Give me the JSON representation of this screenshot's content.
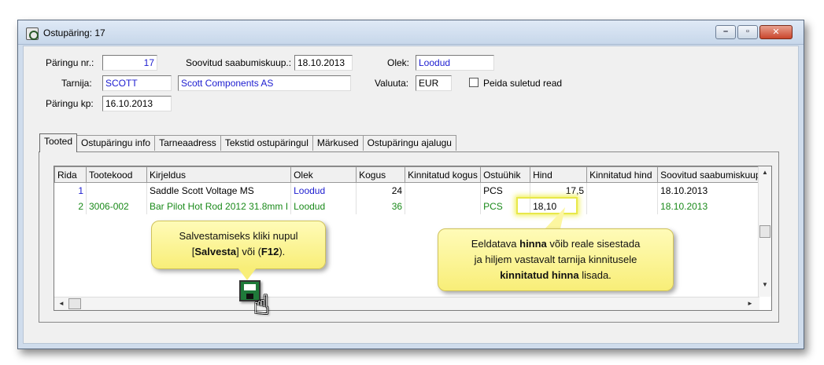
{
  "window": {
    "title": "Ostupäring: 17",
    "buttons": {
      "minimize": "–",
      "maximize": "▫",
      "close": "✕"
    }
  },
  "header": {
    "request_no_label": "Päringu nr.:",
    "request_no": "17",
    "desired_arrival_label": "Soovitud saabumiskuup.:",
    "desired_arrival": "18.10.2013",
    "status_label": "Olek:",
    "status": "Loodud",
    "supplier_label": "Tarnija:",
    "supplier_code": "SCOTT",
    "supplier_name": "Scott Components AS",
    "currency_label": "Valuuta:",
    "currency": "EUR",
    "hide_closed_label": "Peida suletud read",
    "request_date_label": "Päringu kp:",
    "request_date": "16.10.2013"
  },
  "tabs": [
    {
      "label": "Tooted"
    },
    {
      "label": "Ostupäringu info"
    },
    {
      "label": "Tarneaadress"
    },
    {
      "label": "Tekstid ostupäringul"
    },
    {
      "label": "Märkused"
    },
    {
      "label": "Ostupäringu ajalugu"
    }
  ],
  "grid": {
    "columns": [
      "Rida",
      "Tootekood",
      "Kirjeldus",
      "Olek",
      "Kogus",
      "Kinnitatud kogus",
      "Ostuühik",
      "Hind",
      "Kinnitatud hind",
      "Soovitud saabumiskuup."
    ],
    "rows": [
      {
        "rida": "1",
        "tootekood": "",
        "kirjeldus": "Saddle Scott Voltage MS",
        "olek": "Loodud",
        "kogus": "24",
        "kinnitatud_kogus": "",
        "ostuuhik": "PCS",
        "hind": "17,5",
        "kinnitatud_hind": "",
        "saabumiskuup": "18.10.2013"
      },
      {
        "rida": "2",
        "tootekood": "3006-002",
        "kirjeldus": "Bar Pilot Hot Rod 2012 31.8mm I",
        "olek": "Loodud",
        "kogus": "36",
        "kinnitatud_kogus": "",
        "ostuuhik": "PCS",
        "hind": "18,10",
        "kinnitatud_hind": "",
        "saabumiskuup": "18.10.2013"
      }
    ]
  },
  "callouts": {
    "save": {
      "line1": "Salvestamiseks kliki nupul",
      "open": "[",
      "save_word": "Salvesta",
      "mid": "] või (",
      "key": "F12",
      "close": ")."
    },
    "price": {
      "l1a": "Eeldatava ",
      "l1b": "hinna",
      "l1c": " võib reale sisestada",
      "l2": "ja hiljem vastavalt tarnija kinnitusele",
      "l3a": "kinnitatud hinna",
      "l3b": " lisada."
    }
  }
}
